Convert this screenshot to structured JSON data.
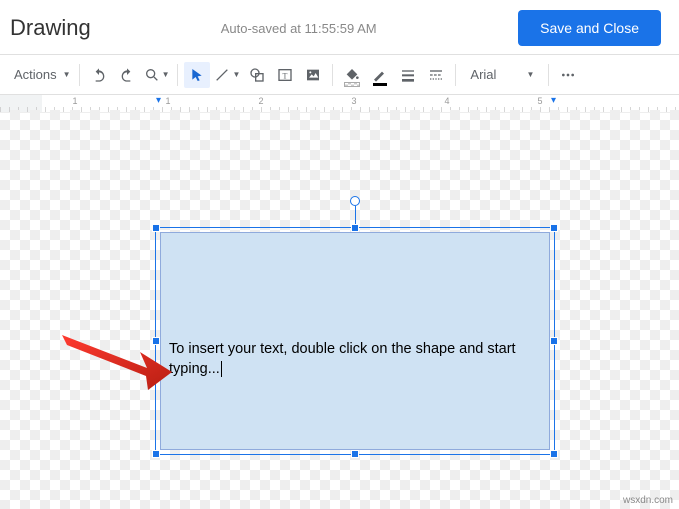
{
  "header": {
    "title": "Drawing",
    "autosave_text": "Auto-saved at 11:55:59 AM",
    "save_and_close_label": "Save and Close"
  },
  "toolbar": {
    "actions_label": "Actions",
    "font_family_value": "Arial"
  },
  "ruler": {
    "numbers": [
      "1",
      "1",
      "2",
      "3",
      "4",
      "5"
    ]
  },
  "shape": {
    "text_content": "To insert your text, double click on the shape and start typing..."
  },
  "watermark": "wsxdn.com"
}
